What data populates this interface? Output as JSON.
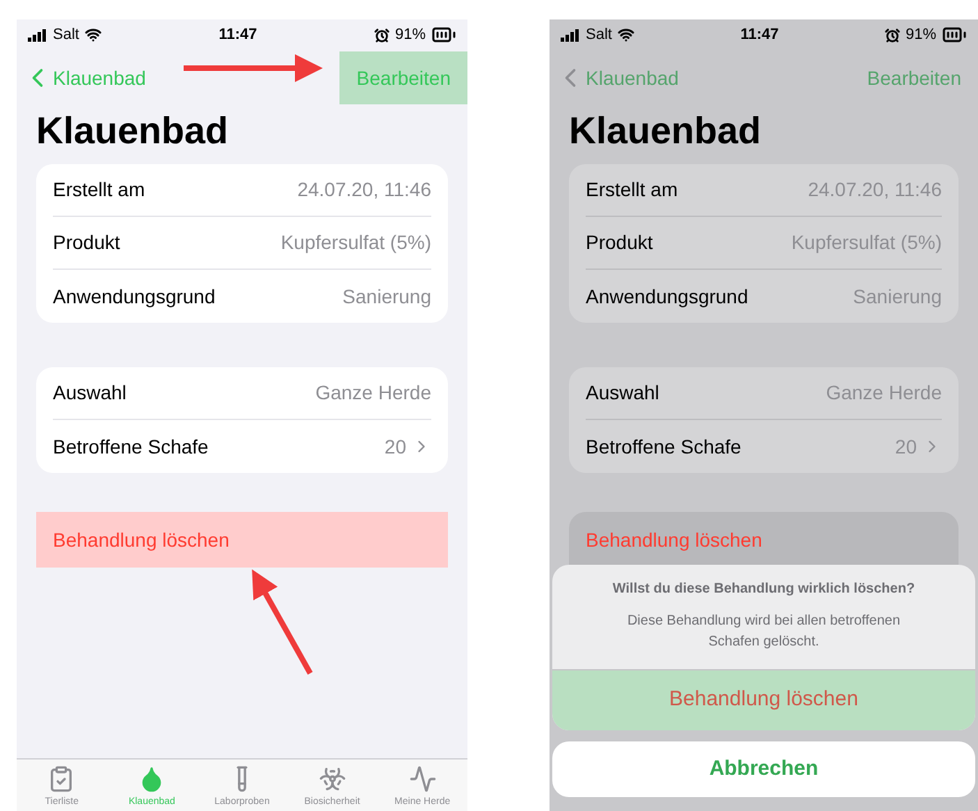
{
  "left_screen": {
    "status_bar": {
      "carrier": "Salt",
      "time": "11:47",
      "battery": "91%"
    },
    "nav": {
      "back": "Klauenbad",
      "action": {
        "label": "Bearbeiten",
        "highlighted": true
      }
    },
    "title": "Klauenbad",
    "details": [
      {
        "kind": "info",
        "label": "Erstellt am",
        "value": "24.07.20, 11:46"
      },
      {
        "kind": "info",
        "label": "Produkt",
        "value": "Kupfersulfat (5%)"
      },
      {
        "kind": "info",
        "label": "Anwendungsgrund",
        "value": "Sanierung"
      }
    ],
    "selection": [
      {
        "kind": "info",
        "label": "Auswahl",
        "value": "Ganze Herde"
      },
      {
        "kind": "link",
        "label": "Betroffene Schafe",
        "value": "20"
      }
    ],
    "delete": {
      "label": "Behandlung löschen",
      "highlighted": true
    },
    "tabs": [
      {
        "label": "Tierliste",
        "selected": false
      },
      {
        "label": "Klauenbad",
        "selected": true
      },
      {
        "label": "Laborproben",
        "selected": false
      },
      {
        "label": "Biosicherheit",
        "selected": false
      },
      {
        "label": "Meine Herde",
        "selected": false
      }
    ]
  },
  "right_screen": {
    "status_bar": {
      "carrier": "Salt",
      "time": "11:47",
      "battery": "91%"
    },
    "nav": {
      "back": "Klauenbad",
      "action": {
        "label": "Bearbeiten",
        "highlighted": false
      }
    },
    "title": "Klauenbad",
    "details": [
      {
        "kind": "info",
        "label": "Erstellt am",
        "value": "24.07.20, 11:46"
      },
      {
        "kind": "info",
        "label": "Produkt",
        "value": "Kupfersulfat (5%)"
      },
      {
        "kind": "info",
        "label": "Anwendungsgrund",
        "value": "Sanierung"
      }
    ],
    "selection": [
      {
        "kind": "info",
        "label": "Auswahl",
        "value": "Ganze Herde"
      },
      {
        "kind": "link",
        "label": "Betroffene Schafe",
        "value": "20"
      }
    ],
    "delete": {
      "label": "Behandlung löschen",
      "highlighted": false
    },
    "action_sheet": {
      "title": "Willst du diese Behandlung wirklich löschen?",
      "message": "Diese Behandlung wird bei allen betroffenen Schafen gelöscht.",
      "confirm": {
        "label": "Behandlung löschen",
        "highlighted": true
      },
      "cancel": {
        "label": "Abbrechen"
      }
    }
  }
}
